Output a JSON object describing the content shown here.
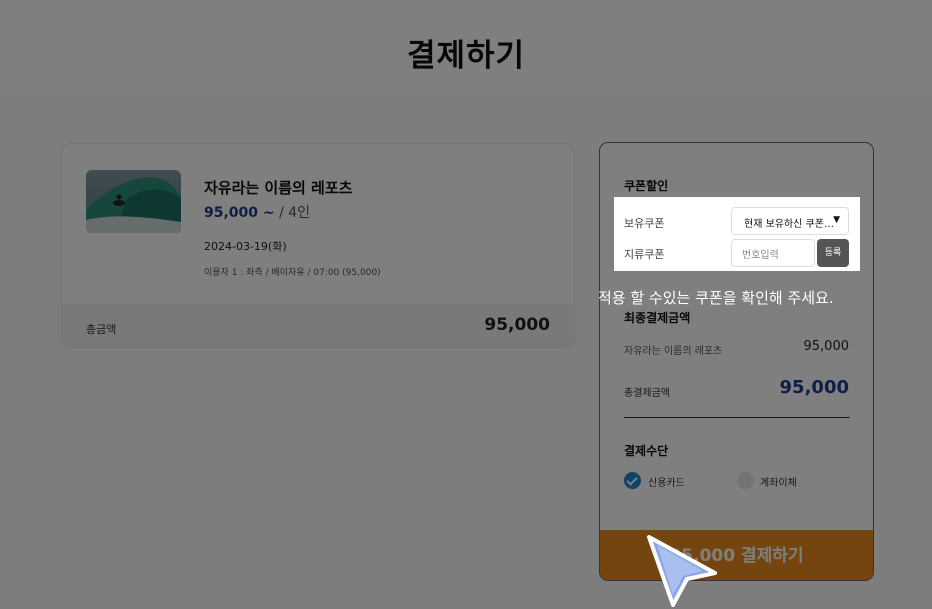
{
  "header": {
    "title": "결제하기"
  },
  "product": {
    "name": "자유라는 이름의 레포츠",
    "price": "95,000 ~",
    "people": " / 4인",
    "date": "2024-03-19(화)",
    "option": "이용자 1 : 좌측 / 베이자유 / 07:00 (95,000)",
    "total_label": "총금액",
    "total_value": "95,000"
  },
  "coupon": {
    "title": "쿠폰할인",
    "owned_label": "보유쿠폰",
    "owned_value": "현재 보유하신 쿠폰…",
    "paper_label": "지류쿠폰",
    "paper_placeholder": "번호입력",
    "register_label": "등록"
  },
  "tooltip": {
    "text": "적용 할 수있는 쿠폰을 확인해 주세요."
  },
  "final": {
    "title": "최종결제금액",
    "item_label": "자유라는 이름의 레포츠",
    "item_value": "95,000",
    "total_label": "총결제금액",
    "total_value": "95,000"
  },
  "method": {
    "title": "결제수단",
    "options": [
      {
        "label": "신용카드",
        "checked": true
      },
      {
        "label": "계좌이체",
        "checked": false
      }
    ]
  },
  "pay_button": {
    "label": "95,000 결제하기"
  },
  "colors": {
    "accent": "#1f3a93",
    "pay_button": "#e88a1f",
    "radio_checked": "#1e88c8"
  }
}
